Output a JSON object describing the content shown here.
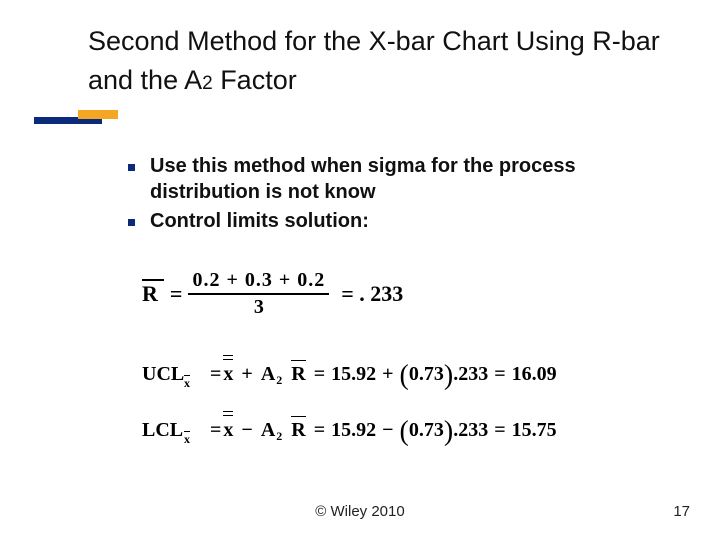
{
  "title": {
    "line": "Second Method for the X-bar Chart Using R-bar and the A",
    "sub": "2",
    "tail": " Factor"
  },
  "bullets": [
    "Use this method when sigma for the process distribution is not know",
    "Control limits solution:"
  ],
  "equations": {
    "rbar": {
      "lhs": "R",
      "eqsym": "=",
      "num": "0.2 + 0.3 + 0.2",
      "den": "3",
      "rhs": "= . 233"
    },
    "ucl": {
      "label": "UCL",
      "expr_left": "= ",
      "op": "+",
      "a2": "0.73",
      "rval": ".233",
      "result": "16.09",
      "xbarbar": "x",
      "Asym": "A",
      "Rsym": "R",
      "xval": "15.92"
    },
    "lcl": {
      "label": "LCL",
      "expr_left": "= ",
      "op": "−",
      "a2": "0.73",
      "rval": ".233",
      "result": "15.75",
      "xbarbar": "x",
      "Asym": "A",
      "Rsym": "R",
      "xval": "15.92"
    }
  },
  "footer": "© Wiley 2010",
  "page": "17"
}
